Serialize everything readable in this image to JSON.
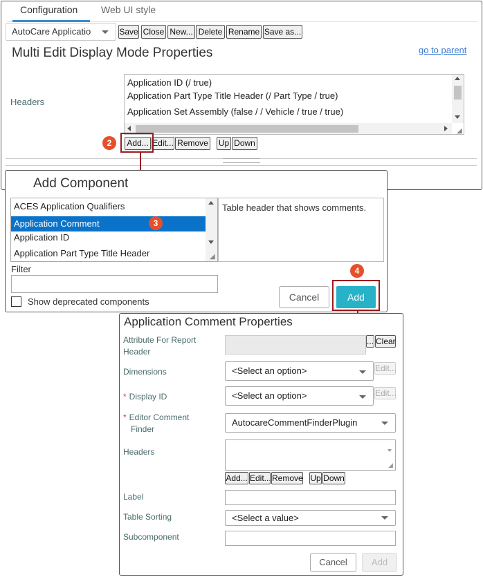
{
  "tabs": [
    {
      "label": "Configuration"
    },
    {
      "label": "Web UI style"
    }
  ],
  "toolbar": {
    "app_select_value": "AutoCare Applicatio",
    "buttons": [
      "Save",
      "Close",
      "New...",
      "Delete",
      "Rename",
      "Save as..."
    ]
  },
  "main": {
    "title": "Multi Edit Display Mode Properties",
    "go_to_parent": "go to parent",
    "headers_label": "Headers",
    "headers_items": [
      "Application ID (/ true)",
      "Application Part Type Title Header (/ Part Type / true)",
      "Application Set Assembly (false / / Vehicle / true / true)"
    ],
    "header_buttons": [
      "Add...",
      "Edit...",
      "Remove",
      "Up",
      "Down"
    ]
  },
  "steps": {
    "s2": "2",
    "s3": "3",
    "s4": "4"
  },
  "add_component": {
    "title": "Add Component",
    "items": [
      "ACES Application Qualifiers",
      "Application Comment",
      "Application ID",
      "Application Part Type Title Header"
    ],
    "selected_index": 1,
    "description": "Table header that shows comments.",
    "filter_label": "Filter",
    "filter_value": "",
    "show_deprecated_label": "Show deprecated components",
    "show_deprecated_checked": false,
    "cancel_label": "Cancel",
    "add_label": "Add"
  },
  "properties": {
    "title": "Application Comment Properties",
    "attr_label_1": "Attribute For Report",
    "attr_label_2": "Header",
    "attr_btn_ellipsis": "...",
    "attr_btn_clear": "Clear",
    "dimensions_label": "Dimensions",
    "dimensions_value": "<Select an option>",
    "dimensions_edit": "Edit...",
    "display_id_label": "Display ID",
    "display_id_value": "<Select an option>",
    "display_id_edit": "Edit...",
    "editor_label_1": "Editor Comment",
    "editor_label_2": "Finder",
    "editor_value": "AutocareCommentFinderPlugin",
    "headers_label": "Headers",
    "header_buttons": [
      "Add...",
      "Edit...",
      "Remove",
      "Up",
      "Down"
    ],
    "label_label": "Label",
    "table_sorting_label": "Table Sorting",
    "table_sorting_value": "<Select a value>",
    "subcomponent_label": "Subcomponent",
    "cancel_label": "Cancel",
    "add_label": "Add",
    "required_mark": "*"
  },
  "colors": {
    "accent": "#28b2c8",
    "selection": "#0a73c9",
    "step_badge": "#e5502a",
    "highlight": "#9b1c1c",
    "link": "#3a7bd5"
  }
}
